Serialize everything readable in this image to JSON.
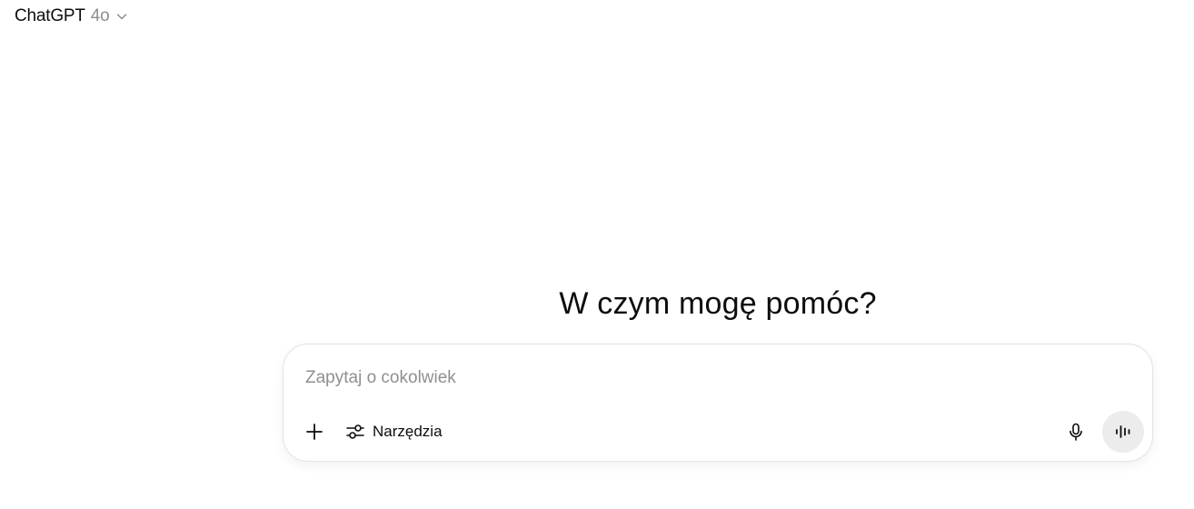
{
  "header": {
    "model_name": "ChatGPT",
    "model_version": "4o",
    "dropdown_icon": "chevron-down-icon"
  },
  "main": {
    "headline": "W czym mogę pomóc?"
  },
  "composer": {
    "placeholder": "Zapytaj o cokolwiek",
    "value": "",
    "attach_icon": "plus-icon",
    "tools_label": "Narzędzia",
    "tools_icon": "sliders-icon",
    "mic_icon": "microphone-icon",
    "voice_icon": "voice-waveform-icon"
  },
  "colors": {
    "text": "#0d0d0d",
    "muted": "#8e8e8e",
    "border": "#e3e3e3",
    "voice_button_bg": "#ececec",
    "background": "#ffffff"
  }
}
